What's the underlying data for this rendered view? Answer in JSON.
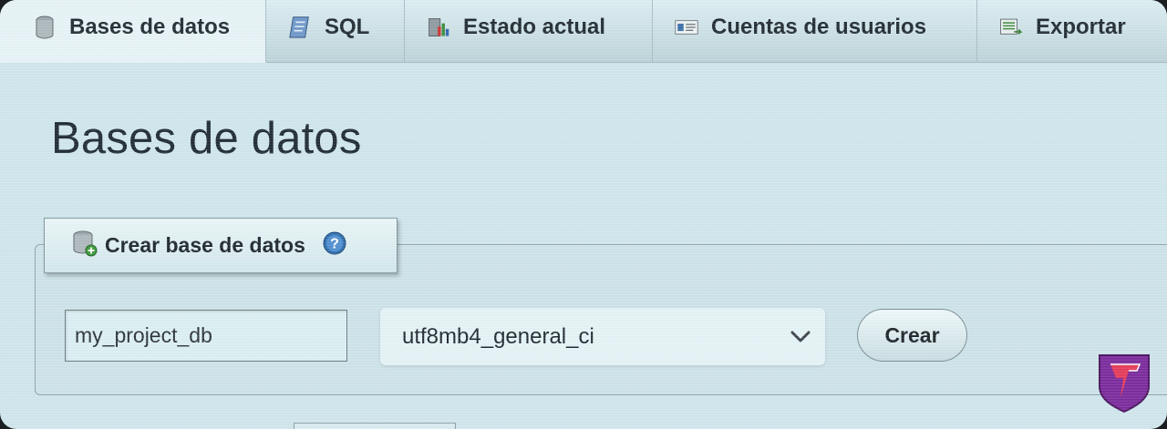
{
  "tabs": [
    {
      "label": "Bases de datos",
      "icon": "database-icon",
      "active": true
    },
    {
      "label": "SQL",
      "icon": "sql-scroll-icon",
      "active": false
    },
    {
      "label": "Estado actual",
      "icon": "status-chart-icon",
      "active": false
    },
    {
      "label": "Cuentas de usuarios",
      "icon": "user-accounts-icon",
      "active": false
    },
    {
      "label": "Exportar",
      "icon": "export-icon",
      "active": false
    }
  ],
  "page": {
    "title": "Bases de datos"
  },
  "create": {
    "legend": "Crear base de datos",
    "db_name_value": "my_project_db",
    "collation_selected": "utf8mb4_general_ci",
    "button_label": "Crear"
  },
  "colors": {
    "background": "#cfe6ec",
    "text": "#1e2a33",
    "help_icon": "#2f6fb0",
    "logo": "#7a2a9c"
  }
}
